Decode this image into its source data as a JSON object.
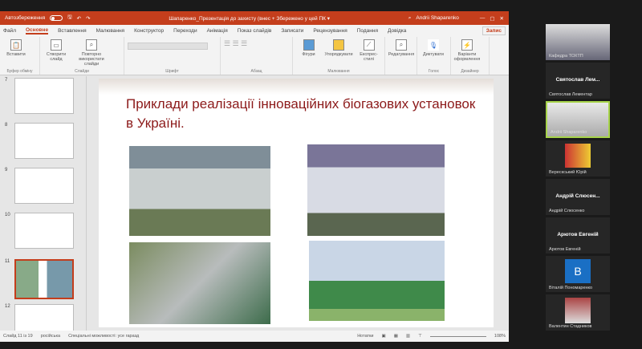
{
  "titlebar": {
    "autosave": "Автозбереження",
    "doc_title": "Шапаренко_Презентація до захисту (внес + Збережено у цей ПК ▾",
    "user": "Andrii Shaparenko"
  },
  "tabs": [
    "Файл",
    "Основне",
    "Вставлення",
    "Малювання",
    "Конструктор",
    "Переходи",
    "Анімація",
    "Показ слайдів",
    "Записати",
    "Рецензування",
    "Подання",
    "Довідка"
  ],
  "record_button": "Запис",
  "ribbon": {
    "clipboard": {
      "label": "Буфер обміну",
      "paste": "Вставити"
    },
    "slides": {
      "label": "Слайди",
      "new": "Створити слайд",
      "reuse": "Повторно використати слайди"
    },
    "font": {
      "label": "Шрифт"
    },
    "paragraph": {
      "label": "Абзац"
    },
    "drawing": {
      "label": "Малювання",
      "shapes": "Фігури",
      "arrange": "Упорядкувати",
      "quick": "Експрес-стилі"
    },
    "editing": {
      "label": "",
      "edit": "Редагування"
    },
    "voice": {
      "label": "Голос",
      "dictate": "Диктувати"
    },
    "designer": {
      "label": "Дизайнер",
      "design": "Варіанти оформлення"
    }
  },
  "thumbnails": [
    "7",
    "8",
    "9",
    "10",
    "11",
    "12"
  ],
  "slide": {
    "title": "Приклади реалізації інноваційних біогазових установок в Україні."
  },
  "status": {
    "slide": "Слайд 11 із 19",
    "lang": "російська",
    "access": "Спеціальні можливості: усе гаразд",
    "notes": "Нотатки",
    "zoom": "108%"
  },
  "participants": [
    {
      "name": "Кафедра ТОХТП",
      "video": true
    },
    {
      "name": "Святослав Лементар",
      "display": "Святослав Лем..."
    },
    {
      "name": "Andrii Shaparenko",
      "video": true,
      "active": true
    },
    {
      "name": "Верескський Юрій",
      "video": true
    },
    {
      "name": "Андрій Слюсенко",
      "display": "Андрій Слюсен..."
    },
    {
      "name": "Арютов Евгеній",
      "display": "Арютов Евгеній"
    },
    {
      "name": "Віталій Пономаренко",
      "display": "B"
    },
    {
      "name": "Валентин Стадников",
      "video": true
    }
  ]
}
